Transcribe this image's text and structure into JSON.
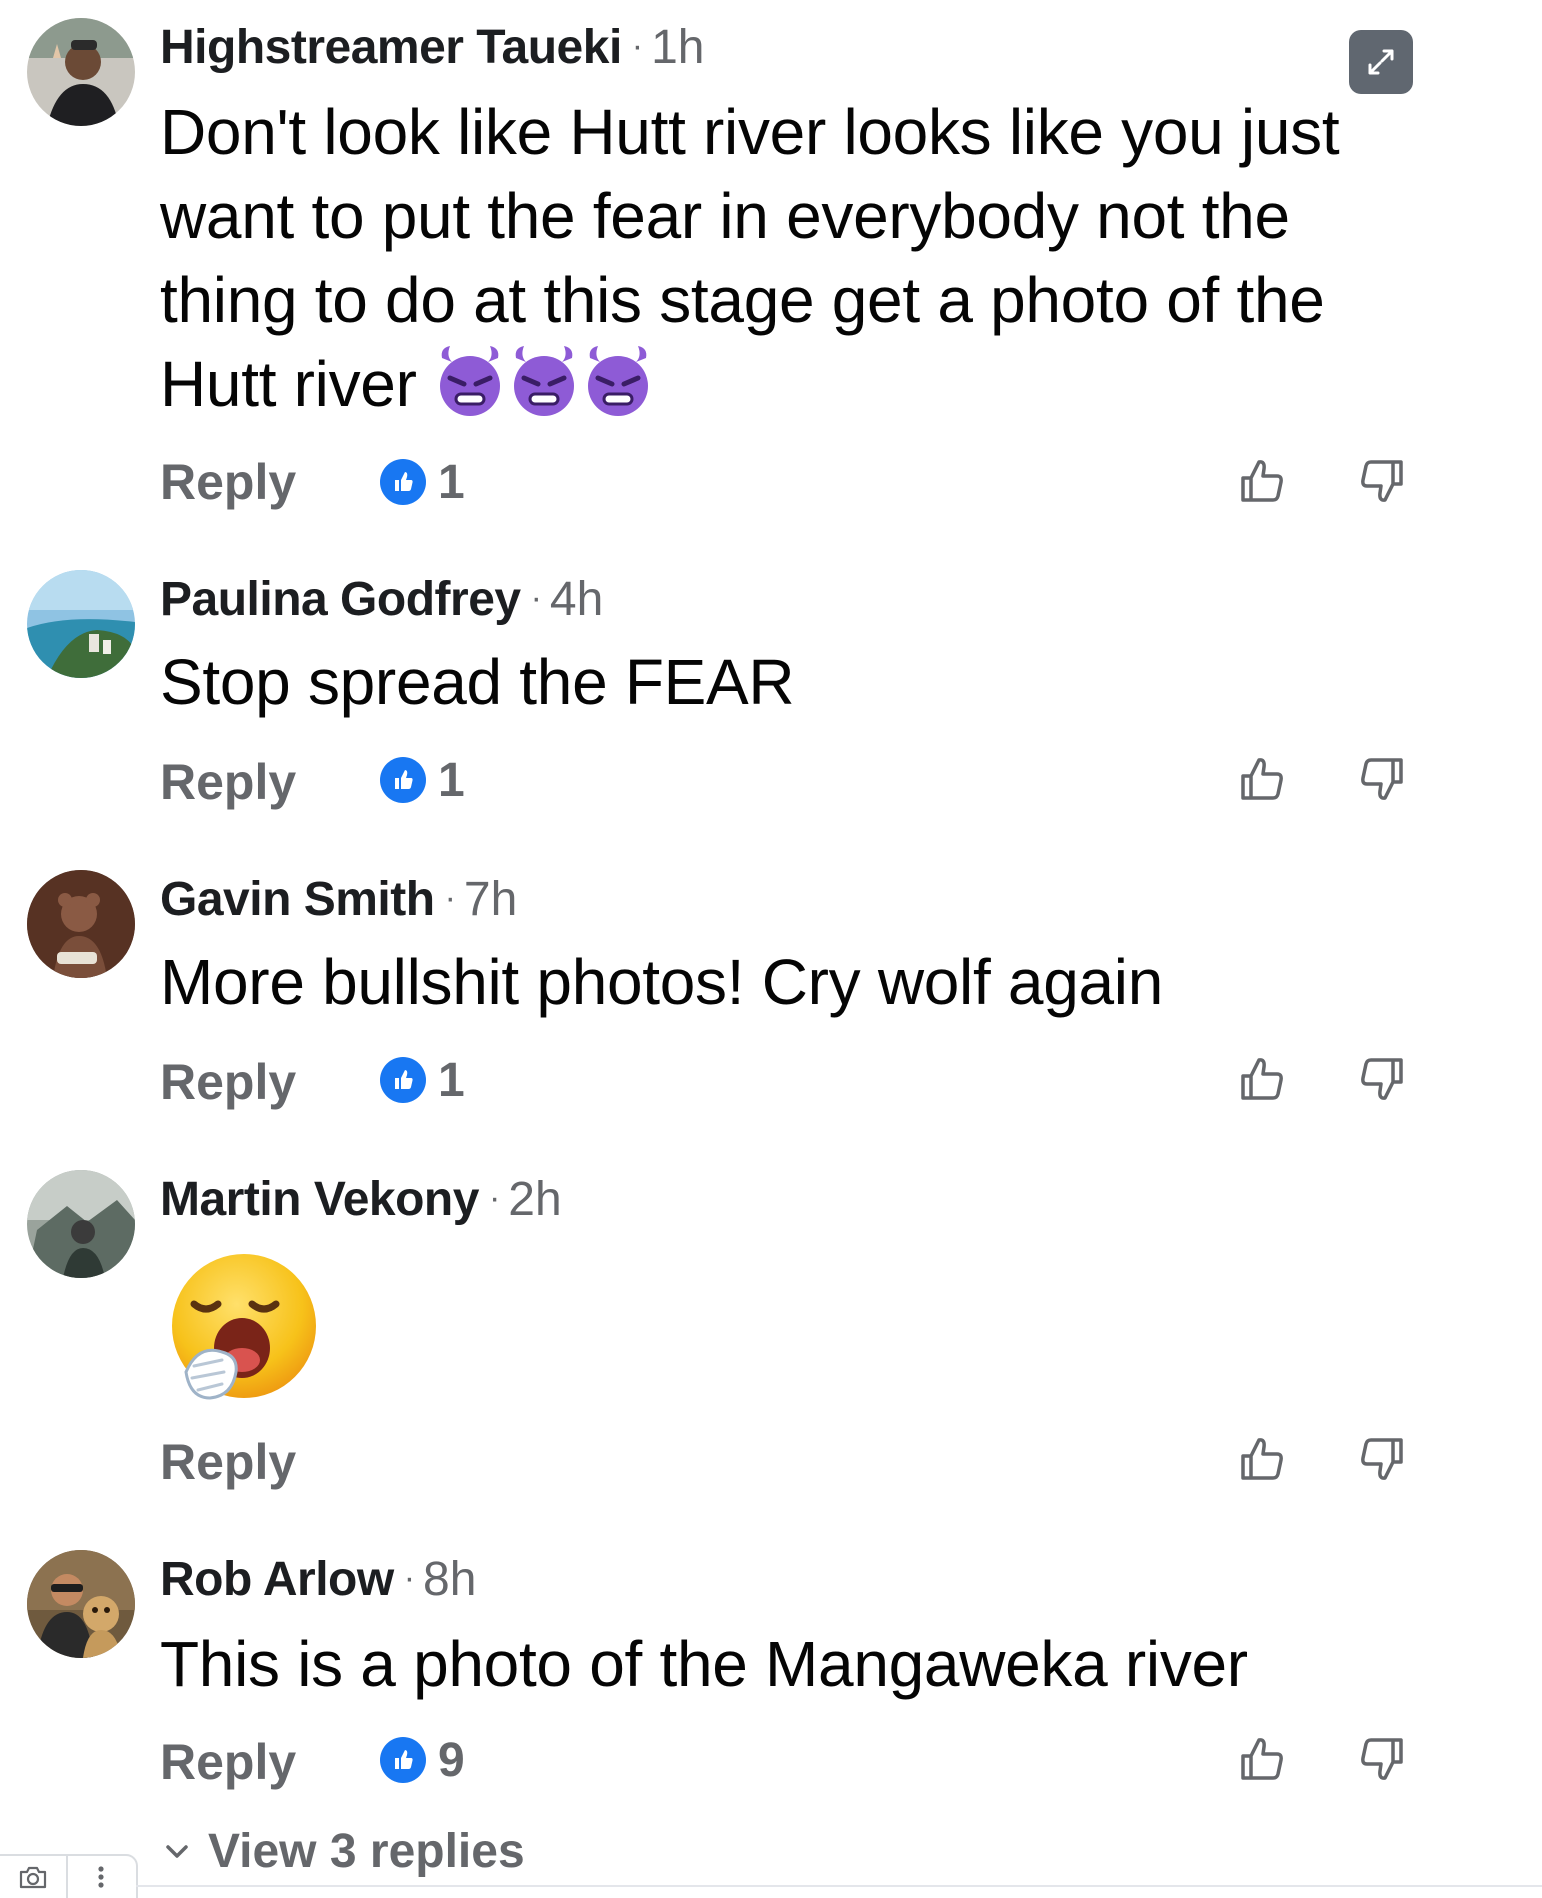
{
  "comments": [
    {
      "author": "Highstreamer Taueki",
      "time": "1h",
      "text": "Don't look like Hutt river looks like you just want to put the fear in everybody not the thing to do at this stage get a photo of the Hutt river",
      "reply_label": "Reply",
      "like_count": "1",
      "emoji": "smiling-devil-purple x3"
    },
    {
      "author": "Paulina Godfrey",
      "time": "4h",
      "text": "Stop spread the FEAR",
      "reply_label": "Reply",
      "like_count": "1"
    },
    {
      "author": "Gavin Smith",
      "time": "7h",
      "text": "More bullshit photos! Cry wolf again",
      "reply_label": "Reply",
      "like_count": "1"
    },
    {
      "author": "Martin Vekony",
      "time": "2h",
      "emoji": "yawning-face",
      "reply_label": "Reply"
    },
    {
      "author": "Rob Arlow",
      "time": "8h",
      "text": "This is a photo of the Mangaweka river",
      "reply_label": "Reply",
      "like_count": "9",
      "view_replies_label": "View 3 replies"
    }
  ],
  "separator": "·",
  "icons": {
    "expand": "expand-arrows-icon",
    "like_badge": "thumbs-up-badge-icon",
    "upvote": "thumbs-up-outline-icon",
    "downvote": "thumbs-down-outline-icon",
    "chevron": "chevron-down-icon",
    "camera": "camera-icon",
    "more": "more-vertical-icon"
  },
  "colors": {
    "like_blue": "#1877f2",
    "secondary_text": "#65676b",
    "devil_purple": "#8e5bd6",
    "yawn_yellow": "#f7c21a"
  }
}
